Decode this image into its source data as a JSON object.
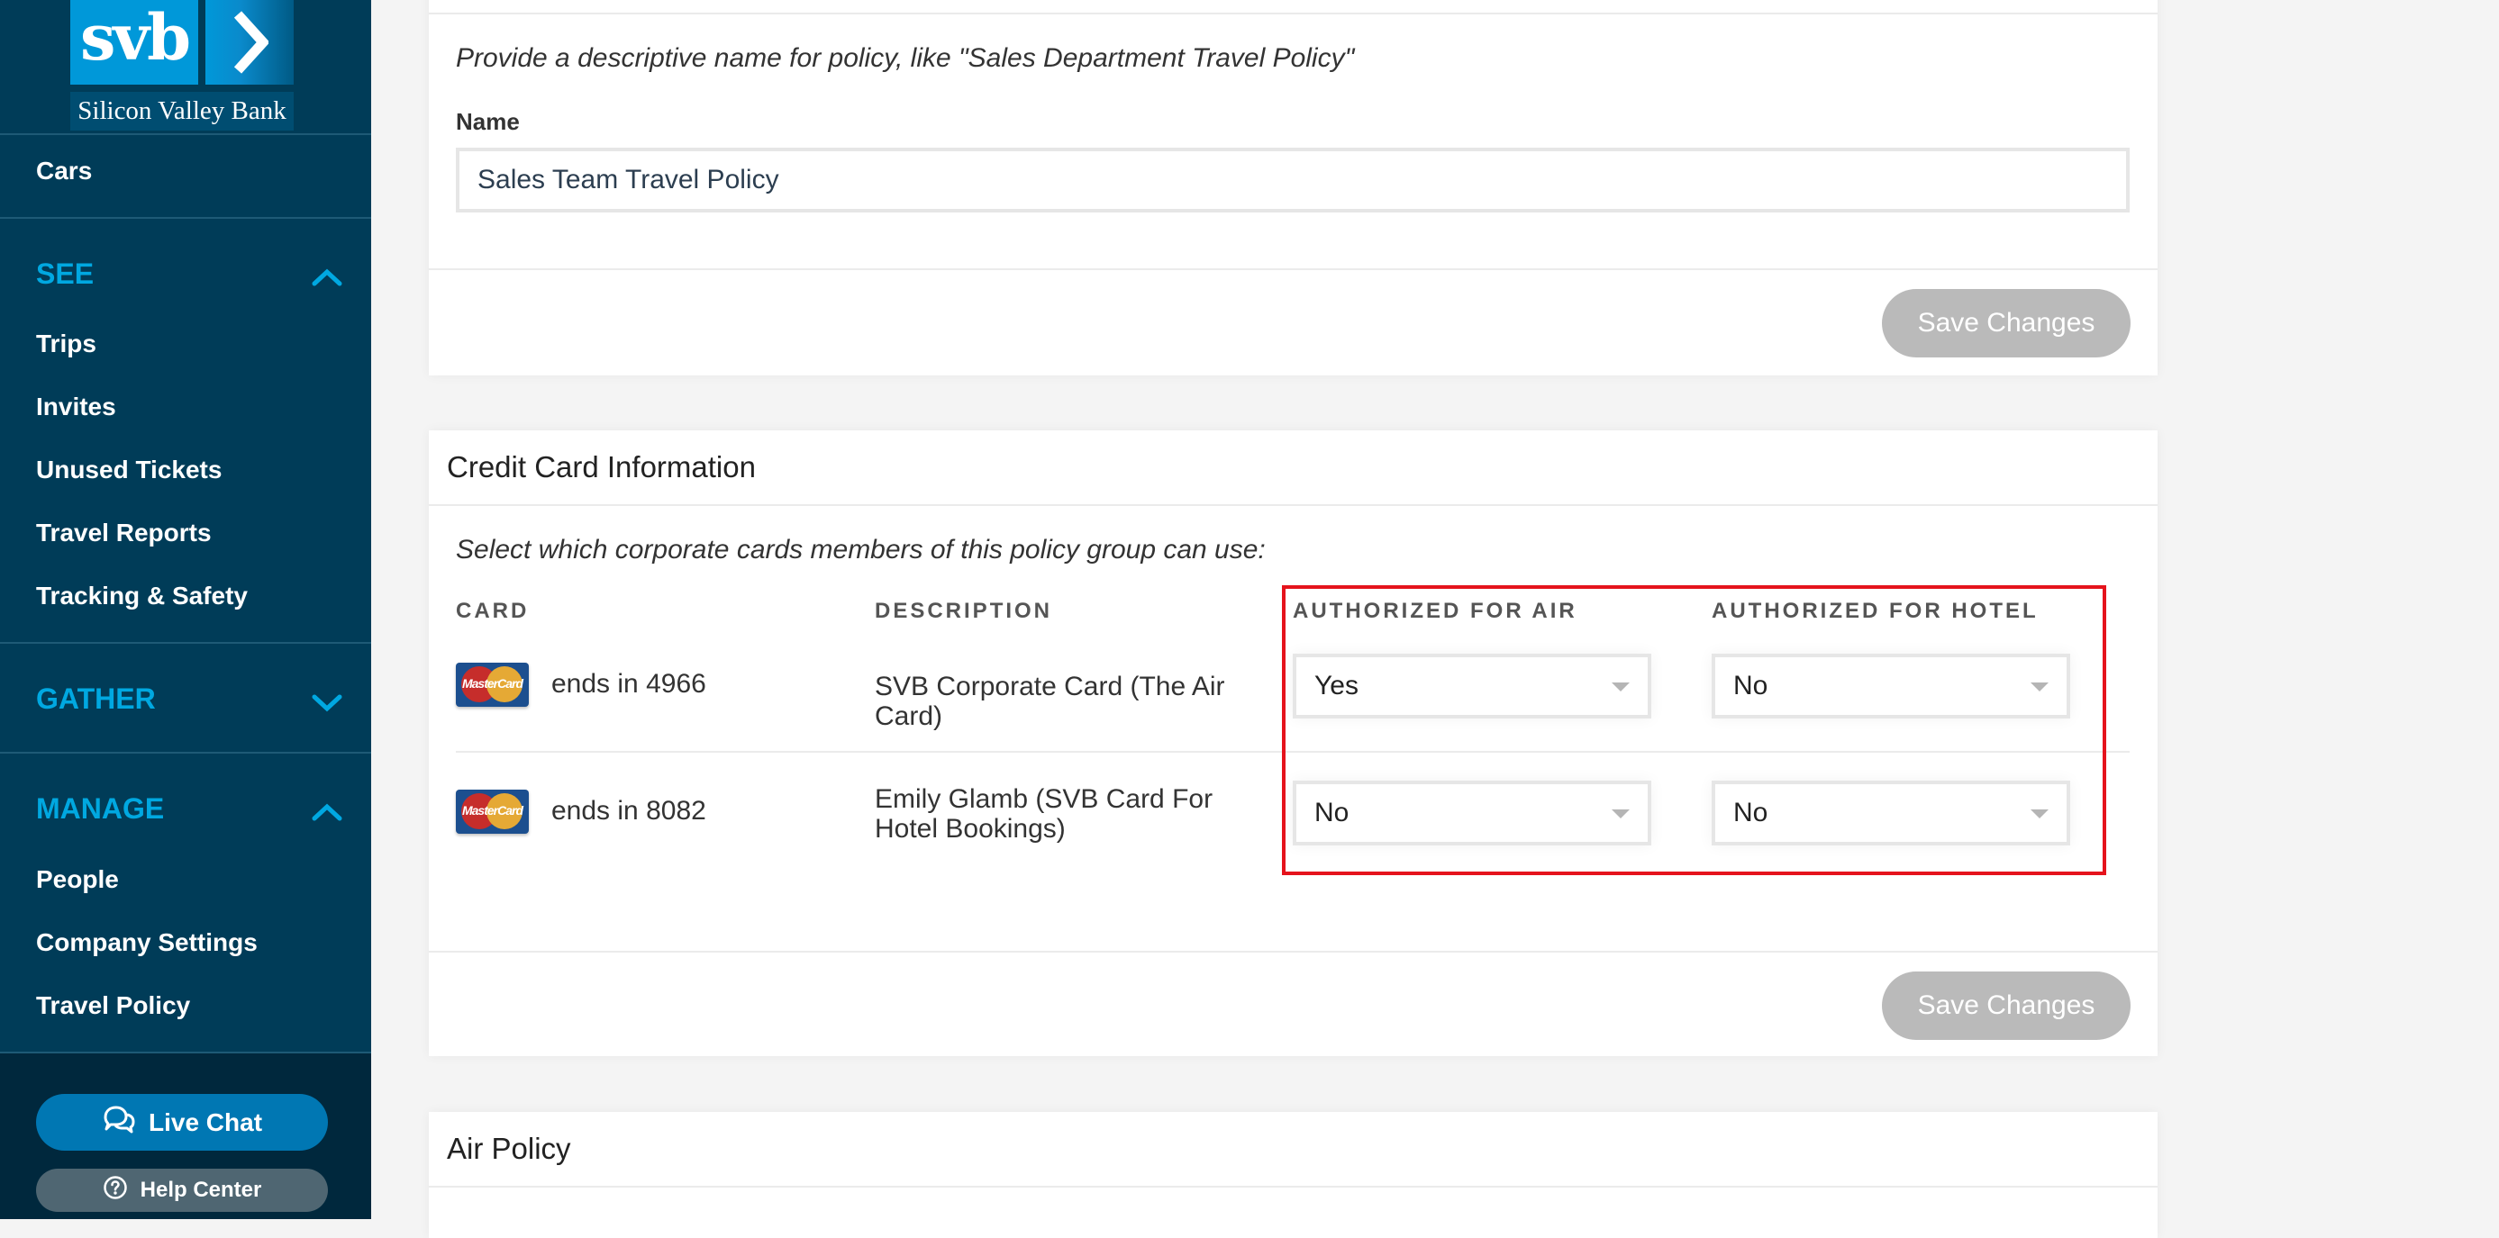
{
  "brand": {
    "logo_text": "svb",
    "logo_subtext": "Silicon Valley Bank",
    "colors": {
      "sidebar": "#003c58",
      "accent": "#00a8e1",
      "live_chat": "#0077b3",
      "highlight": "#e5131c"
    }
  },
  "sidebar": {
    "top_items": [
      {
        "label": "Cars"
      }
    ],
    "sections": [
      {
        "label": "SEE",
        "expanded": true,
        "chevron": "chevron-up-icon",
        "items": [
          {
            "label": "Trips"
          },
          {
            "label": "Invites"
          },
          {
            "label": "Unused Tickets"
          },
          {
            "label": "Travel Reports"
          },
          {
            "label": "Tracking & Safety"
          }
        ]
      },
      {
        "label": "GATHER",
        "expanded": false,
        "chevron": "chevron-down-icon",
        "items": []
      },
      {
        "label": "MANAGE",
        "expanded": true,
        "chevron": "chevron-up-icon",
        "items": [
          {
            "label": "People"
          },
          {
            "label": "Company Settings"
          },
          {
            "label": "Travel Policy"
          }
        ]
      }
    ],
    "live_chat_label": "Live Chat",
    "help_center_label": "Help Center"
  },
  "policy_name_card": {
    "hint": "Provide a descriptive name for policy, like \"Sales Department Travel Policy\"",
    "name_label": "Name",
    "name_value": "Sales Team Travel Policy",
    "save_label": "Save Changes"
  },
  "credit_card_card": {
    "title": "Credit Card Information",
    "hint": "Select which corporate cards members of this policy group can use:",
    "columns": [
      "CARD",
      "DESCRIPTION",
      "AUTHORIZED FOR AIR",
      "AUTHORIZED FOR HOTEL"
    ],
    "rows": [
      {
        "card_brand": "MasterCard",
        "card": "ends in 4966",
        "description": "SVB Corporate Card (The Air Card)",
        "air": "Yes",
        "hotel": "No"
      },
      {
        "card_brand": "MasterCard",
        "card": "ends in 8082",
        "description": "Emily Glamb (SVB Card For Hotel Bookings)",
        "air": "No",
        "hotel": "No"
      }
    ],
    "save_label": "Save Changes"
  },
  "air_policy_card": {
    "title": "Air Policy"
  }
}
